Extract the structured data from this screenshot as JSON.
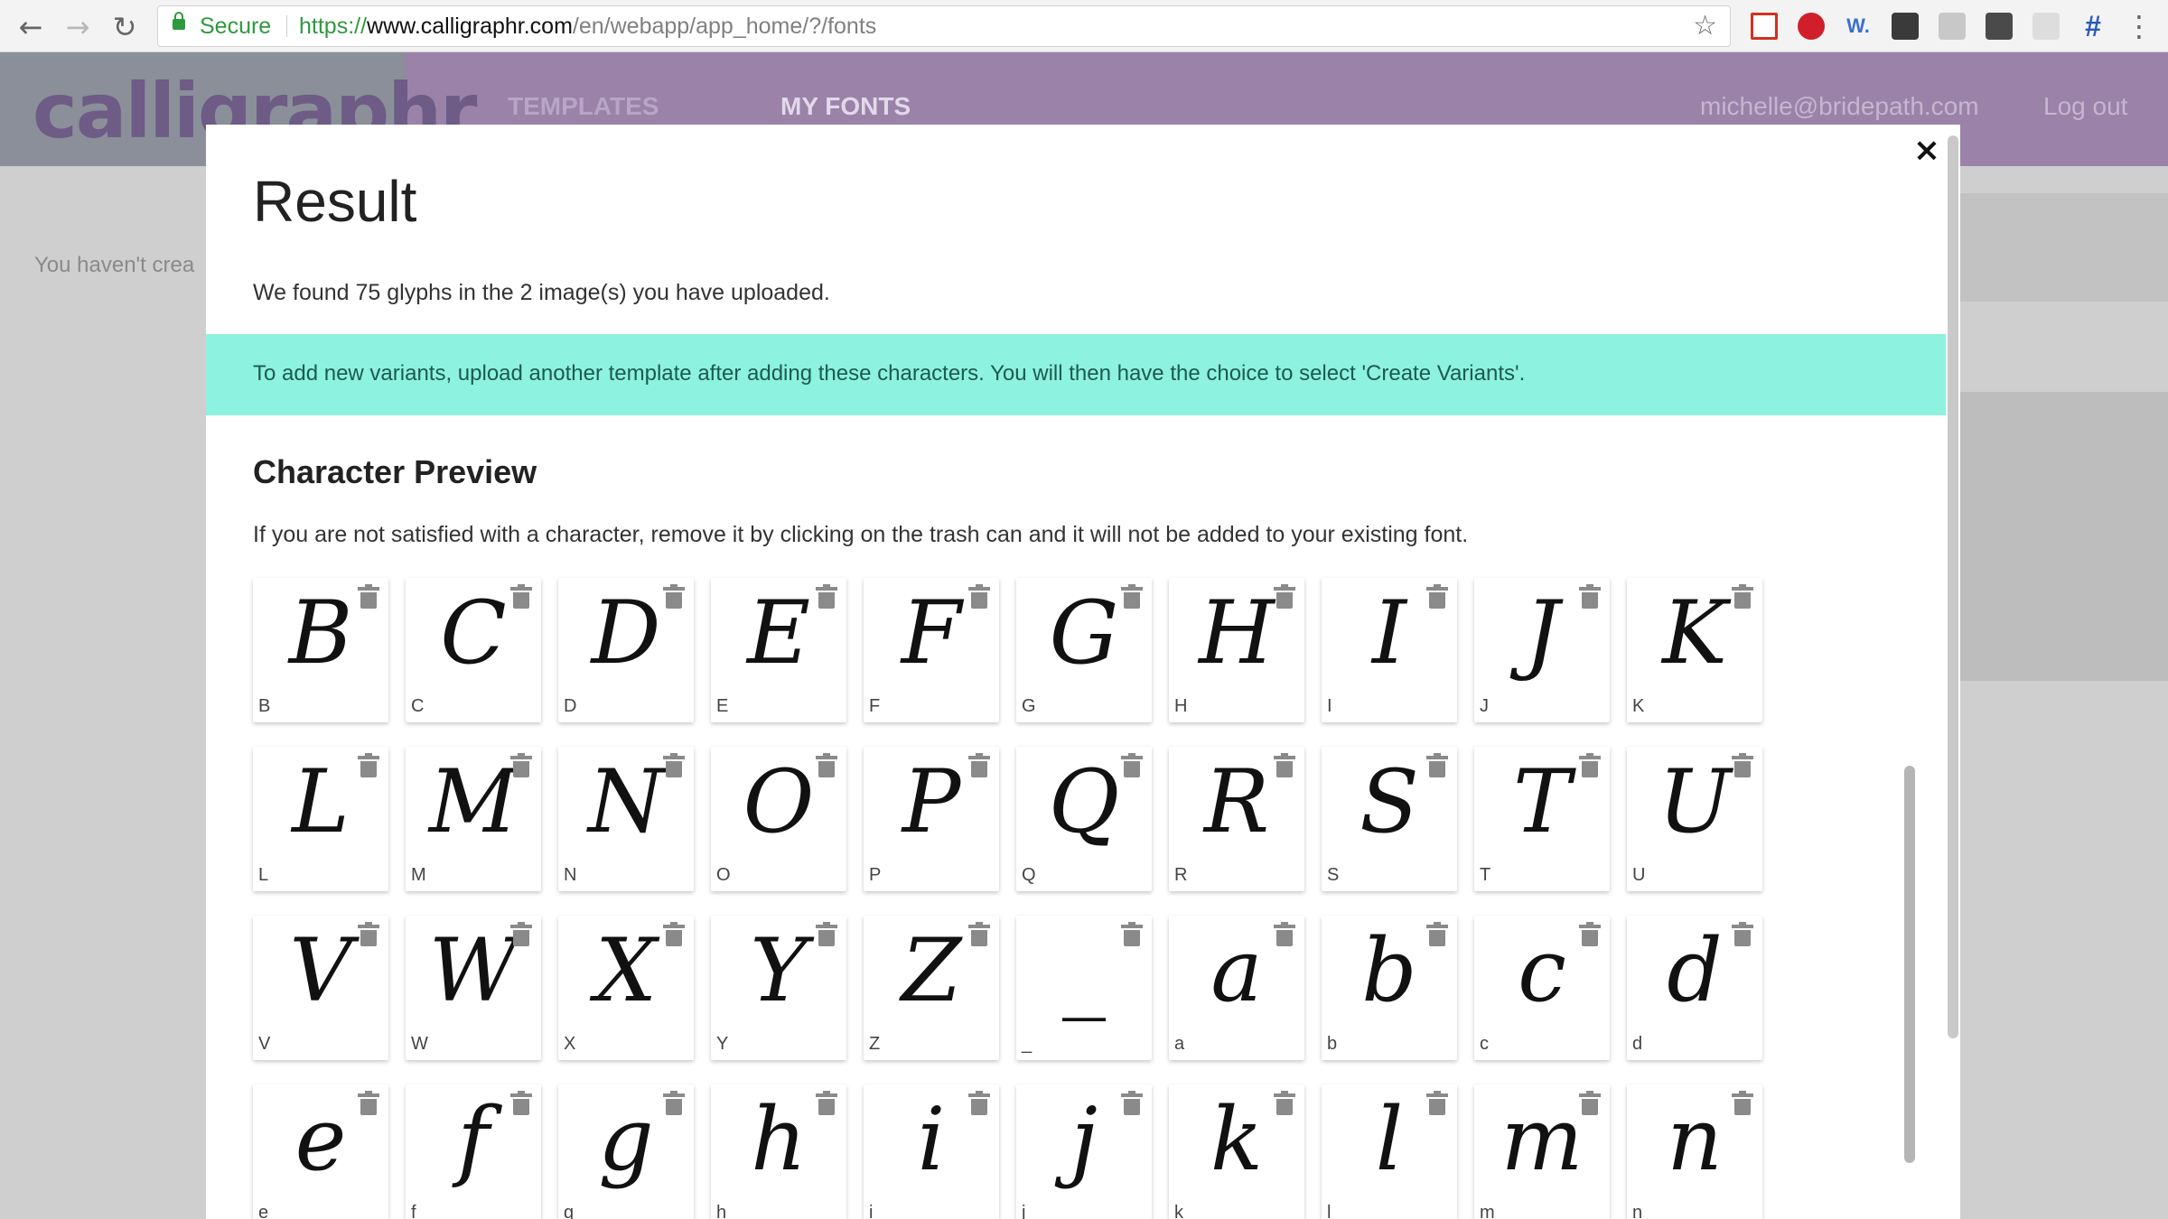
{
  "browser": {
    "secure_label": "Secure",
    "url_scheme": "https://",
    "url_host": "www.calligraphr.com",
    "url_path": "/en/webapp/app_home/?/fonts",
    "extension_w": "W.",
    "extension_hash": "#"
  },
  "site": {
    "logo": "calligraphr",
    "nav": {
      "templates": "TEMPLATES",
      "my_fonts": "MY FONTS"
    },
    "user_email": "michelle@bridepath.com",
    "logout": "Log out",
    "background_notice": "You haven't crea"
  },
  "modal": {
    "close": "×",
    "title": "Result",
    "summary": "We found 75 glyphs in the 2 image(s) you have uploaded.",
    "info": "To add new variants, upload another template after adding these characters. You will then have the choice to select 'Create Variants'.",
    "preview_title": "Character Preview",
    "preview_desc": "If you are not satisfied with a character, remove it by clicking on the trash can and it will not be added to your existing font."
  },
  "glyphs": [
    {
      "char": "B",
      "label": "B"
    },
    {
      "char": "C",
      "label": "C"
    },
    {
      "char": "D",
      "label": "D"
    },
    {
      "char": "E",
      "label": "E"
    },
    {
      "char": "F",
      "label": "F"
    },
    {
      "char": "G",
      "label": "G"
    },
    {
      "char": "H",
      "label": "H"
    },
    {
      "char": "I",
      "label": "I"
    },
    {
      "char": "J",
      "label": "J"
    },
    {
      "char": "K",
      "label": "K"
    },
    {
      "char": "L",
      "label": "L"
    },
    {
      "char": "M",
      "label": "M"
    },
    {
      "char": "N",
      "label": "N"
    },
    {
      "char": "O",
      "label": "O"
    },
    {
      "char": "P",
      "label": "P"
    },
    {
      "char": "Q",
      "label": "Q"
    },
    {
      "char": "R",
      "label": "R"
    },
    {
      "char": "S",
      "label": "S"
    },
    {
      "char": "T",
      "label": "T"
    },
    {
      "char": "U",
      "label": "U"
    },
    {
      "char": "V",
      "label": "V"
    },
    {
      "char": "W",
      "label": "W"
    },
    {
      "char": "X",
      "label": "X"
    },
    {
      "char": "Y",
      "label": "Y"
    },
    {
      "char": "Z",
      "label": "Z"
    },
    {
      "char": "_",
      "label": "_"
    },
    {
      "char": "a",
      "label": "a"
    },
    {
      "char": "b",
      "label": "b"
    },
    {
      "char": "c",
      "label": "c"
    },
    {
      "char": "d",
      "label": "d"
    },
    {
      "char": "e",
      "label": "e"
    },
    {
      "char": "f",
      "label": "f"
    },
    {
      "char": "g",
      "label": "g"
    },
    {
      "char": "h",
      "label": "h"
    },
    {
      "char": "i",
      "label": "i"
    },
    {
      "char": "j",
      "label": "j"
    },
    {
      "char": "k",
      "label": "k"
    },
    {
      "char": "l",
      "label": "l"
    },
    {
      "char": "m",
      "label": "m"
    },
    {
      "char": "n",
      "label": "n"
    }
  ]
}
